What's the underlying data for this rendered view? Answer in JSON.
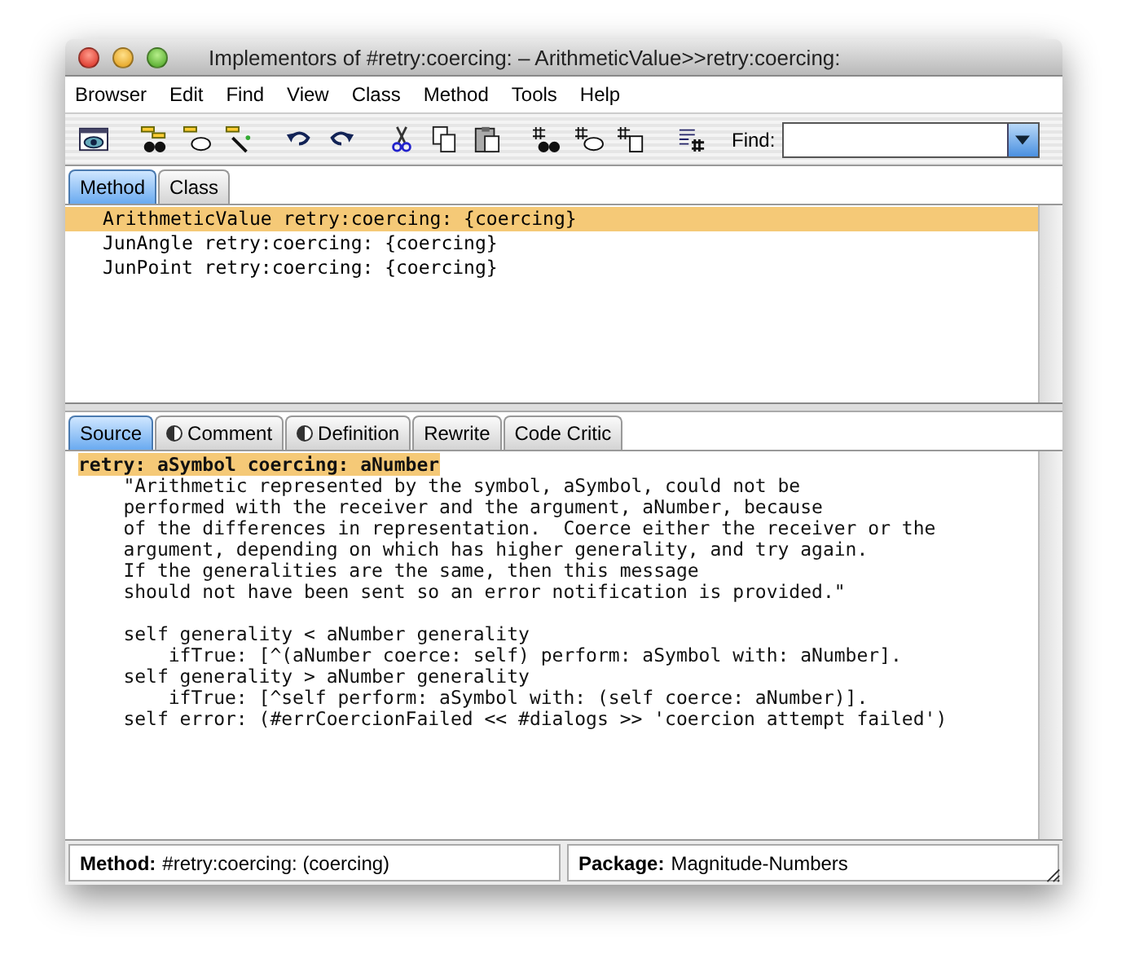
{
  "window": {
    "title": "Implementors of #retry:coercing: – ArithmeticValue>>retry:coercing:"
  },
  "menu": [
    "Browser",
    "Edit",
    "Find",
    "View",
    "Class",
    "Method",
    "Tools",
    "Help"
  ],
  "toolbar": {
    "find_label": "Find:"
  },
  "list_tabs": [
    {
      "label": "Method",
      "selected": true
    },
    {
      "label": "Class",
      "selected": false
    }
  ],
  "methods": [
    {
      "label": "ArithmeticValue retry:coercing: {coercing}",
      "selected": true
    },
    {
      "label": "JunAngle retry:coercing: {coercing}",
      "selected": false
    },
    {
      "label": "JunPoint retry:coercing: {coercing}",
      "selected": false
    }
  ],
  "code_tabs": [
    {
      "label": "Source",
      "selected": true,
      "has_icon": false
    },
    {
      "label": "Comment",
      "selected": false,
      "has_icon": true
    },
    {
      "label": "Definition",
      "selected": false,
      "has_icon": true
    },
    {
      "label": "Rewrite",
      "selected": false,
      "has_icon": false
    },
    {
      "label": "Code Critic",
      "selected": false,
      "has_icon": false
    }
  ],
  "source": {
    "header": "retry: aSymbol coercing: aNumber",
    "lines": [
      {
        "text": "    \"Arithmetic represented by the symbol, aSymbol, could not be",
        "blank_before": false
      },
      {
        "text": "    performed with the receiver and the argument, aNumber, because",
        "blank_before": false
      },
      {
        "text": "    of the differences in representation.  Coerce either the receiver or the",
        "blank_before": false
      },
      {
        "text": "    argument, depending on which has higher generality, and try again.",
        "blank_before": false
      },
      {
        "text": "    If the generalities are the same, then this message",
        "blank_before": false
      },
      {
        "text": "    should not have been sent so an error notification is provided.\"",
        "blank_before": false
      },
      {
        "text": "    self generality < aNumber generality",
        "blank_before": true
      },
      {
        "text": "        ifTrue: [^(aNumber coerce: self) perform: aSymbol with: aNumber].",
        "blank_before": false
      },
      {
        "text": "    self generality > aNumber generality",
        "blank_before": false
      },
      {
        "text": "        ifTrue: [^self perform: aSymbol with: (self coerce: aNumber)].",
        "blank_before": false
      },
      {
        "text": "    self error: (#errCoercionFailed << #dialogs >> 'coercion attempt failed')",
        "blank_before": false
      }
    ]
  },
  "status_bar": [
    {
      "label": "Method:",
      "value": "#retry:coercing: (coercing)"
    },
    {
      "label": "Package:",
      "value": "Magnitude-Numbers"
    }
  ]
}
